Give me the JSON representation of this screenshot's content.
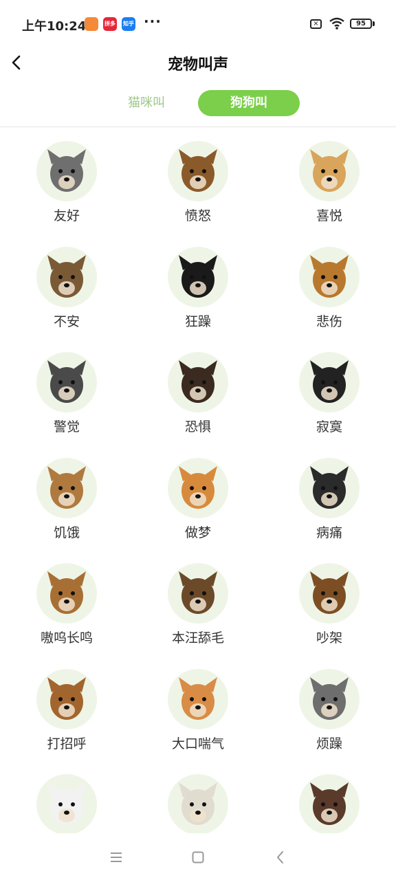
{
  "status_bar": {
    "time": "上午10:24",
    "app_badges": [
      {
        "name": "shopping-app-icon",
        "label": "",
        "color": "#f4893a"
      },
      {
        "name": "red-app-icon",
        "label": "拼多多",
        "color": "#e5273a"
      },
      {
        "name": "zhihu-app-icon",
        "label": "知乎",
        "color": "#1a7ef0"
      }
    ],
    "more_dots": "···",
    "sim_icon": "×",
    "battery": "95"
  },
  "header": {
    "title": "宠物叫声",
    "back_icon": "chevron-left-icon"
  },
  "tabs": [
    {
      "label": "猫咪叫",
      "active": false
    },
    {
      "label": "狗狗叫",
      "active": true
    }
  ],
  "colors": {
    "accent": "#7bcf4a",
    "inactive_tab": "#9fc88a",
    "avatar_bg": "#eef5e6"
  },
  "sounds": [
    {
      "label": "友好",
      "fur": "#6f6f6f"
    },
    {
      "label": "愤怒",
      "fur": "#8b5a2b"
    },
    {
      "label": "喜悦",
      "fur": "#d9a45b"
    },
    {
      "label": "不安",
      "fur": "#7a5a35"
    },
    {
      "label": "狂躁",
      "fur": "#1a1a1a"
    },
    {
      "label": "悲伤",
      "fur": "#b8782e"
    },
    {
      "label": "警觉",
      "fur": "#4a4a4a"
    },
    {
      "label": "恐惧",
      "fur": "#3b2a1f"
    },
    {
      "label": "寂寞",
      "fur": "#222222"
    },
    {
      "label": "饥饿",
      "fur": "#b07a3f"
    },
    {
      "label": "做梦",
      "fur": "#d88a3c"
    },
    {
      "label": "病痛",
      "fur": "#2b2b2b"
    },
    {
      "label": "嗷呜长鸣",
      "fur": "#a86f35"
    },
    {
      "label": "本汪舔毛",
      "fur": "#6b4a2a"
    },
    {
      "label": "吵架",
      "fur": "#7d4e24"
    },
    {
      "label": "打招呼",
      "fur": "#a3652e"
    },
    {
      "label": "大口喘气",
      "fur": "#d98c46"
    },
    {
      "label": "烦躁",
      "fur": "#6e6e6e"
    },
    {
      "label": "",
      "fur": "#f2f2f2"
    },
    {
      "label": "",
      "fur": "#e0dccf"
    },
    {
      "label": "",
      "fur": "#5a3a2a"
    }
  ],
  "nav_bar": {
    "menu_icon": "menu-icon",
    "home_icon": "home-square-icon",
    "back_icon": "back-triangle-icon"
  }
}
